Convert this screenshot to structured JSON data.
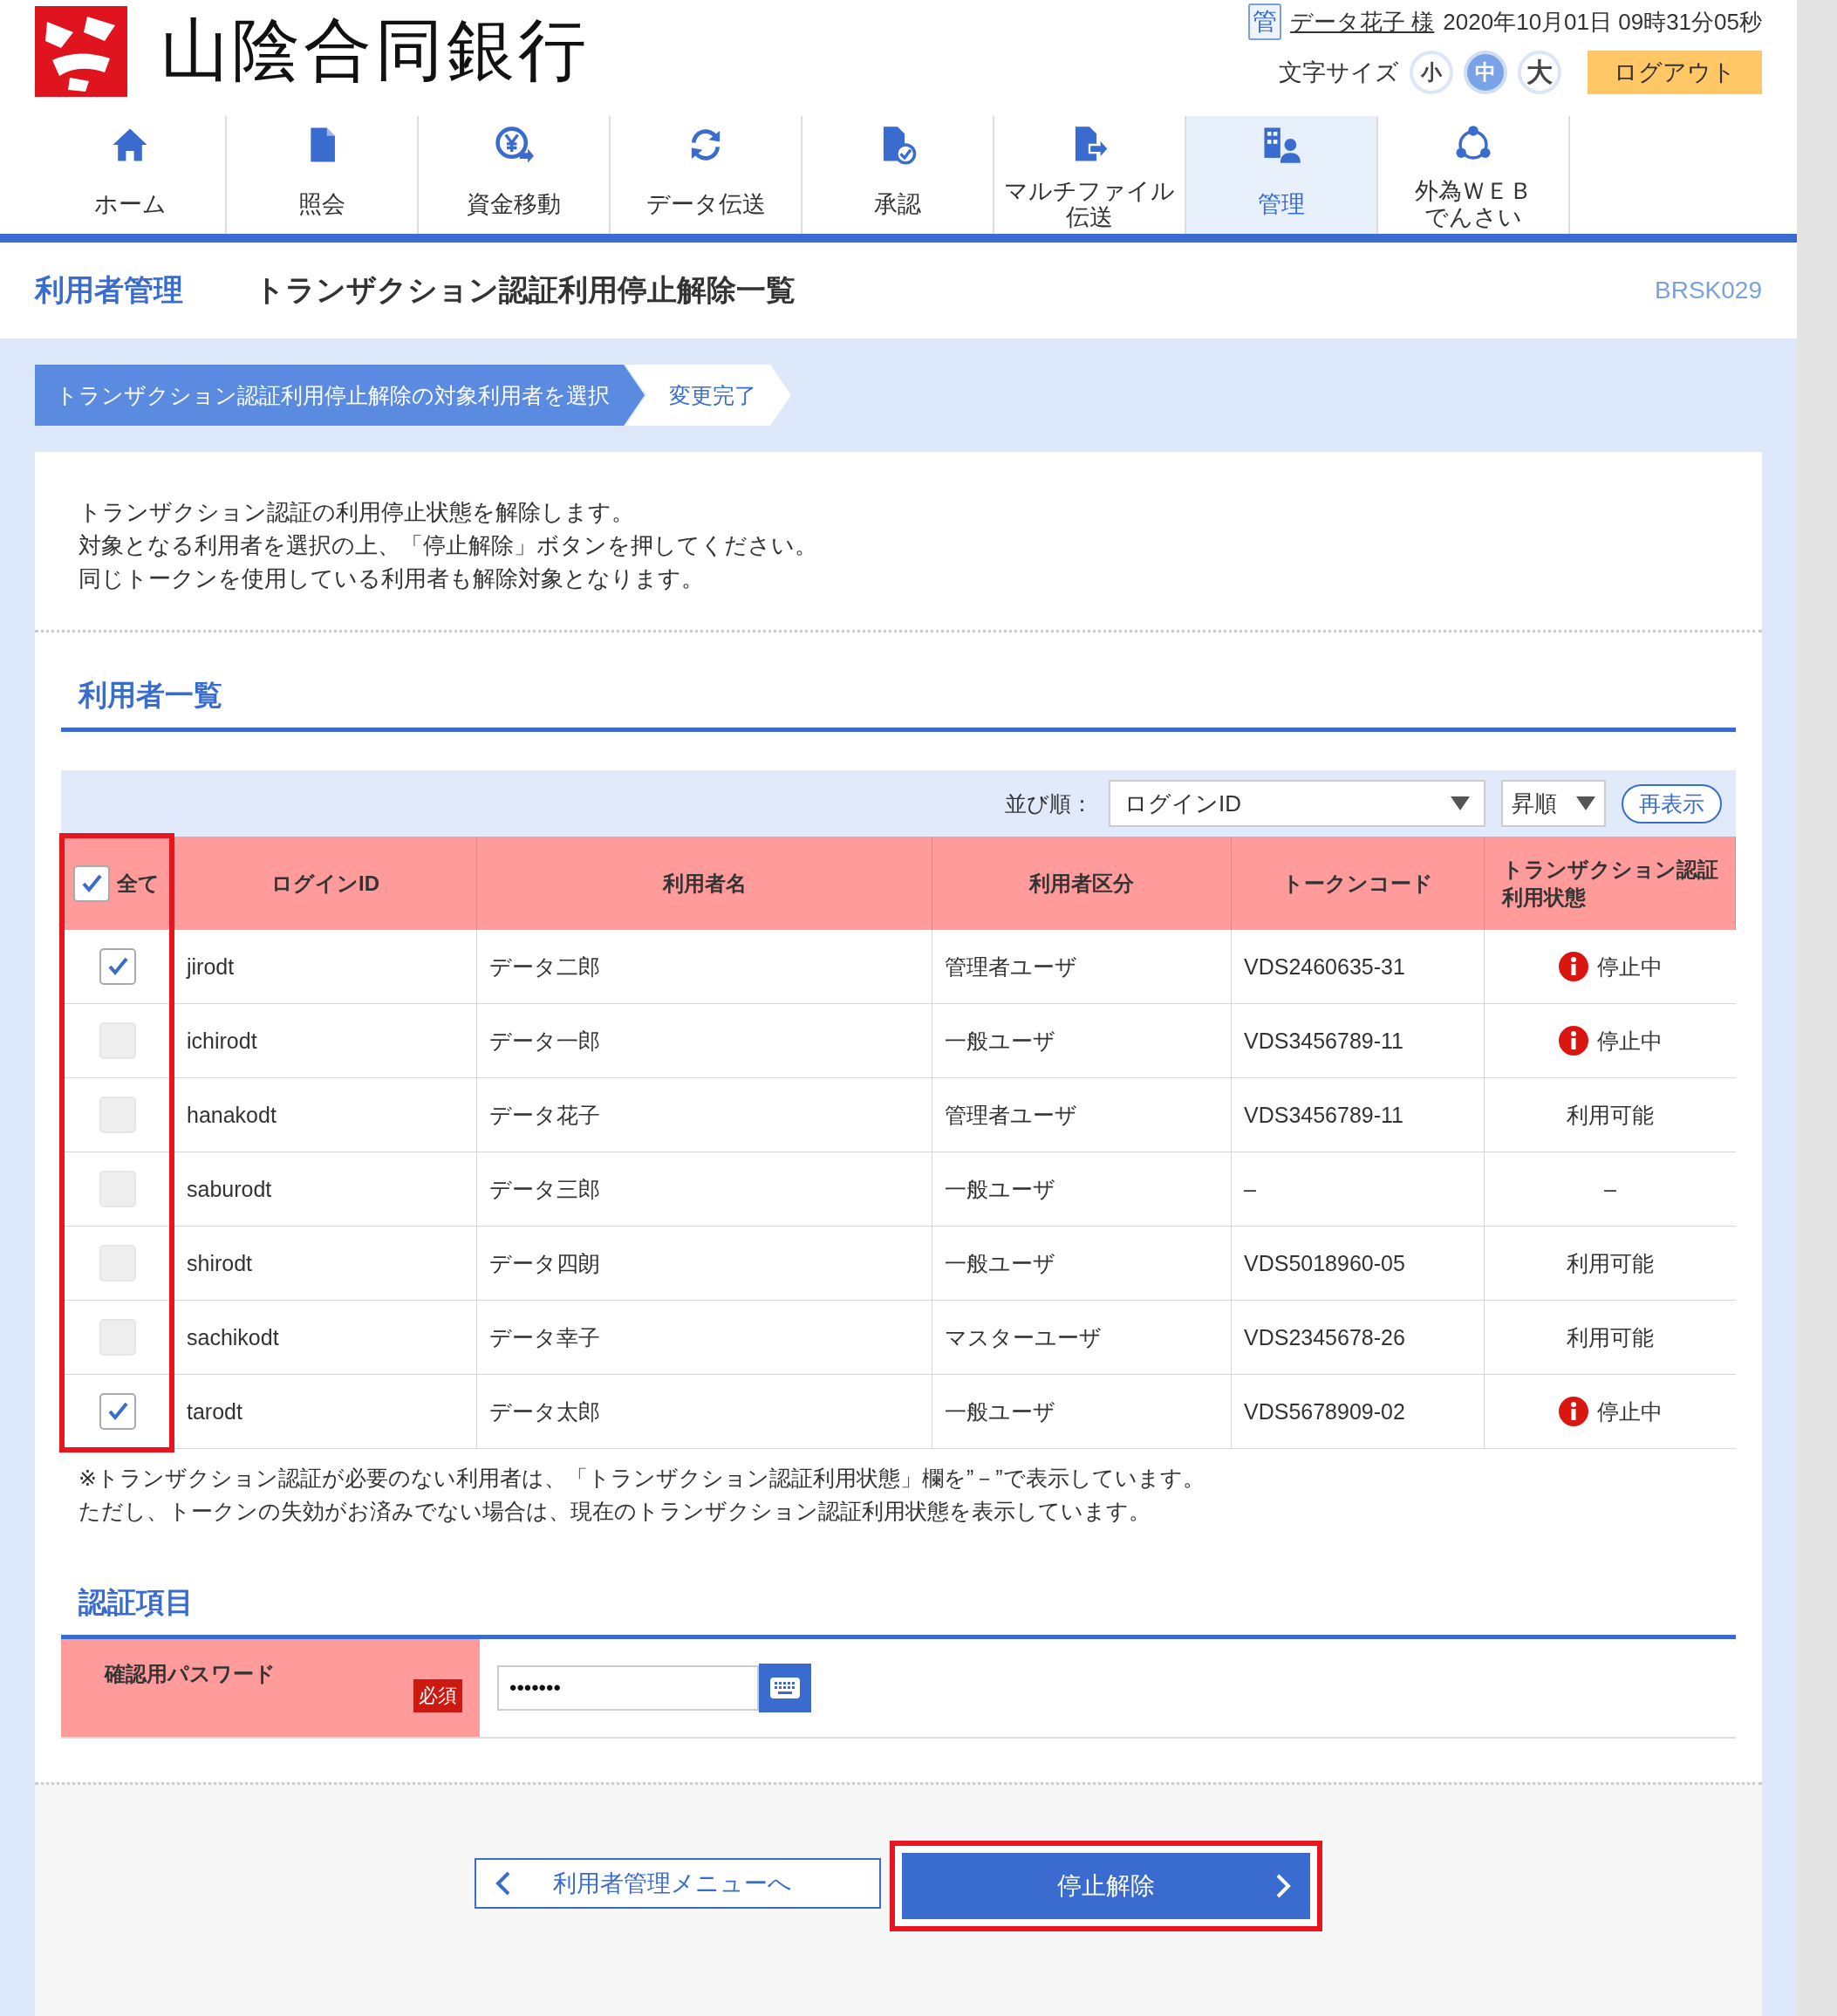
{
  "header": {
    "bank_name": "山陰合同銀行",
    "role_badge": "管",
    "user_name": "データ花子 様",
    "datetime": "2020年10月01日 09時31分05秒",
    "font_size_label": "文字サイズ",
    "font_sizes": [
      {
        "label": "小",
        "selected": false
      },
      {
        "label": "中",
        "selected": true
      },
      {
        "label": "大",
        "selected": false
      }
    ],
    "logout": "ログアウト"
  },
  "nav": [
    {
      "kind": "home",
      "lines": [
        "ホーム"
      ],
      "selected": false
    },
    {
      "kind": "document",
      "lines": [
        "照会"
      ],
      "selected": false
    },
    {
      "kind": "yen",
      "lines": [
        "資金移動"
      ],
      "selected": false
    },
    {
      "kind": "refresh",
      "lines": [
        "データ伝送"
      ],
      "selected": false
    },
    {
      "kind": "approve",
      "lines": [
        "承認"
      ],
      "selected": false
    },
    {
      "kind": "upload",
      "lines": [
        "マルチファイル",
        "伝送"
      ],
      "selected": false
    },
    {
      "kind": "admin",
      "lines": [
        "管理"
      ],
      "selected": true
    },
    {
      "kind": "network",
      "lines": [
        "外為ＷＥＢ",
        "でんさい"
      ],
      "selected": false
    }
  ],
  "page_header": {
    "section": "利用者管理",
    "title": "トランザクション認証利用停止解除一覧",
    "screen_id": "BRSK029"
  },
  "steps": [
    {
      "label": "トランザクション認証利用停止解除の対象利用者を選択",
      "selected": true
    },
    {
      "label": "変更完了",
      "selected": false
    }
  ],
  "intro": [
    "トランザクション認証の利用停止状態を解除します。",
    "対象となる利用者を選択の上、「停止解除」ボタンを押してください。",
    "同じトークンを使用している利用者も解除対象となります。"
  ],
  "user_list": {
    "heading": "利用者一覧",
    "sort_label": "並び順：",
    "sort_field": "ログインID",
    "sort_order": "昇順",
    "refresh": "再表示",
    "select_all": {
      "label": "全て",
      "checked": true
    },
    "columns": [
      {
        "lines": [
          "ログインID"
        ]
      },
      {
        "lines": [
          "利用者名"
        ]
      },
      {
        "lines": [
          "利用者区分"
        ]
      },
      {
        "lines": [
          "トークンコード"
        ]
      },
      {
        "lines": [
          "トランザクション認証",
          "利用状態"
        ]
      }
    ],
    "rows": [
      {
        "checked": true,
        "login_id": "jirodt",
        "name": "データ二郎",
        "type": "管理者ユーザ",
        "token": "VDS2460635-31",
        "status": "停止中",
        "alert": true
      },
      {
        "checked": false,
        "login_id": "ichirodt",
        "name": "データ一郎",
        "type": "一般ユーザ",
        "token": "VDS3456789-11",
        "status": "停止中",
        "alert": true
      },
      {
        "checked": false,
        "login_id": "hanakodt",
        "name": "データ花子",
        "type": "管理者ユーザ",
        "token": "VDS3456789-11",
        "status": "利用可能",
        "alert": false
      },
      {
        "checked": false,
        "login_id": "saburodt",
        "name": "データ三郎",
        "type": "一般ユーザ",
        "token": "–",
        "status": "–",
        "alert": false
      },
      {
        "checked": false,
        "login_id": "shirodt",
        "name": "データ四朗",
        "type": "一般ユーザ",
        "token": "VDS5018960-05",
        "status": "利用可能",
        "alert": false
      },
      {
        "checked": false,
        "login_id": "sachikodt",
        "name": "データ幸子",
        "type": "マスターユーザ",
        "token": "VDS2345678-26",
        "status": "利用可能",
        "alert": false
      },
      {
        "checked": true,
        "login_id": "tarodt",
        "name": "データ太郎",
        "type": "一般ユーザ",
        "token": "VDS5678909-02",
        "status": "停止中",
        "alert": true
      }
    ],
    "notes": [
      "※トランザクション認証が必要のない利用者は、「トランザクション認証利用状態」欄を”－”で表示しています。",
      "ただし、トークンの失効がお済みでない場合は、現在のトランザクション認証利用状態を表示しています。"
    ]
  },
  "auth": {
    "heading": "認証項目",
    "password_label": "確認用パスワード",
    "required": "必須",
    "password_value": "•••••••"
  },
  "buttons": {
    "back": "利用者管理メニューへ",
    "submit": "停止解除"
  }
}
